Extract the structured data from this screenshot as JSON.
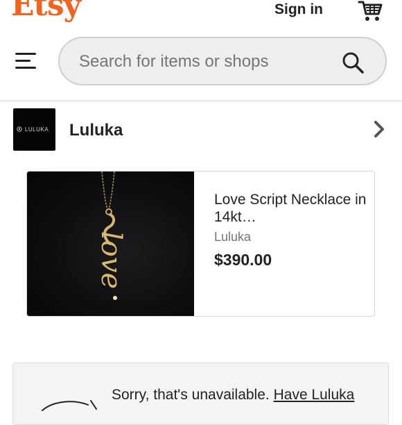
{
  "header": {
    "logo": "Etsy",
    "signin_label": "Sign in",
    "cart_icon": "cart-icon",
    "menu_icon": "hamburger-menu-icon"
  },
  "search": {
    "placeholder": "Search for items or shops",
    "icon": "search-icon"
  },
  "shop": {
    "logo_text": "LULUKA",
    "name": "Luluka",
    "chevron_icon": "chevron-right-icon"
  },
  "listing": {
    "title": "Love Script Necklace in 14kt…",
    "seller": "Luluka",
    "price": "$390.00",
    "image_text": "love"
  },
  "notice": {
    "text": "Sorry, that's unavailable.",
    "link_text": "Have Luluka"
  },
  "colors": {
    "brand": "#F1641E",
    "text": "#222222",
    "muted": "#757575",
    "search_bg": "#EEEEEE"
  }
}
